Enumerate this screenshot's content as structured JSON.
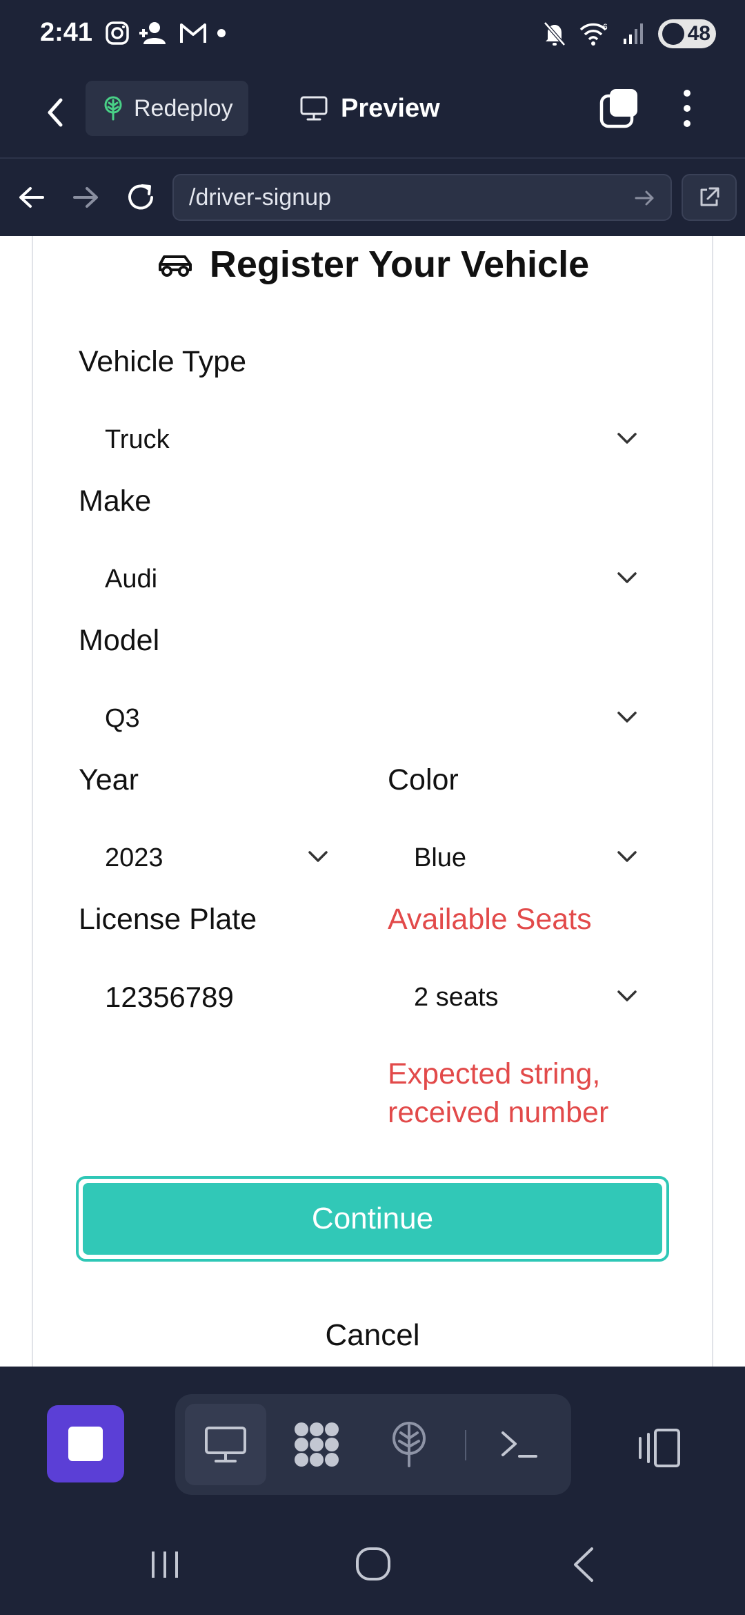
{
  "status_bar": {
    "time": "2:41",
    "battery": "48"
  },
  "toolbar": {
    "redeploy_label": "Redeploy",
    "preview_label": "Preview"
  },
  "url_bar": {
    "url": "/driver-signup"
  },
  "form": {
    "title": "Register Your Vehicle",
    "vehicle_type": {
      "label": "Vehicle Type",
      "value": "Truck"
    },
    "make": {
      "label": "Make",
      "value": "Audi"
    },
    "model": {
      "label": "Model",
      "value": "Q3"
    },
    "year": {
      "label": "Year",
      "value": "2023"
    },
    "color": {
      "label": "Color",
      "value": "Blue"
    },
    "license_plate": {
      "label": "License Plate",
      "value": "12356789"
    },
    "available_seats": {
      "label": "Available Seats",
      "value": "2 seats",
      "error": "Expected string, received number"
    },
    "continue_label": "Continue",
    "cancel_label": "Cancel"
  },
  "colors": {
    "accent": "#31c8b7",
    "error": "#e24a4a",
    "stop": "#5b3fd6",
    "chrome": "#1d2337"
  },
  "icons": {
    "status": [
      "instagram-icon",
      "person-add-icon",
      "gmail-icon",
      "notification-dot-icon",
      "mute-icon",
      "wifi-6-icon",
      "signal-icon",
      "battery-icon"
    ],
    "bottom_tools": [
      "monitor-icon",
      "grid-app-icon",
      "deploy-icon",
      "terminal-icon"
    ]
  }
}
